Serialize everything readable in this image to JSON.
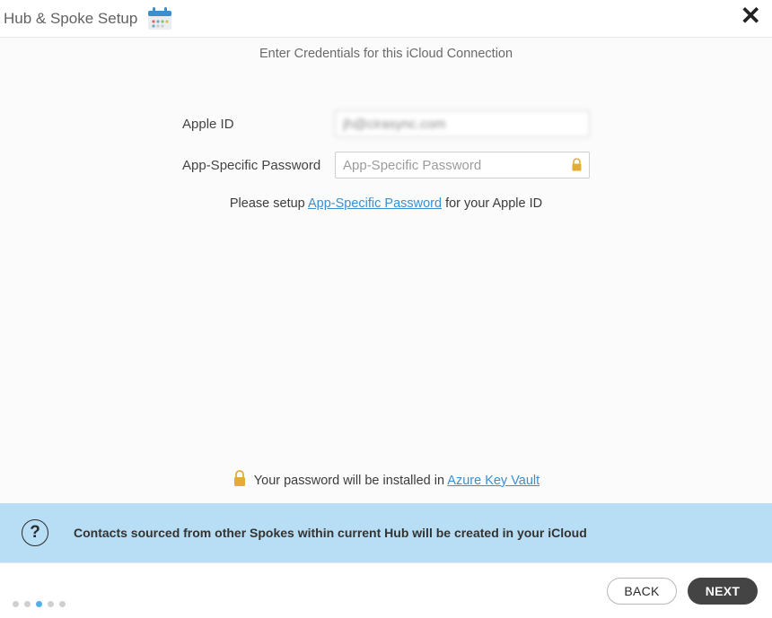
{
  "header": {
    "title": "Hub & Spoke Setup"
  },
  "main": {
    "instruction": "Enter Credentials for this iCloud Connection",
    "apple_id": {
      "label": "Apple ID",
      "value": "jh@cirasync.com"
    },
    "asp": {
      "label": "App-Specific Password",
      "placeholder": "App-Specific Password"
    },
    "hint_pre": "Please setup ",
    "hint_link": "App-Specific Password",
    "hint_post": " for your Apple ID",
    "vault_pre": "Your password will be installed in ",
    "vault_link": "Azure Key Vault"
  },
  "banner": {
    "text": "Contacts sourced from other Spokes within current Hub will be created in your iCloud"
  },
  "footer": {
    "back": "BACK",
    "next": "NEXT",
    "step_active": 2,
    "step_count": 5
  },
  "colors": {
    "accent": "#55b0e6",
    "lock": "#e4ab36"
  }
}
